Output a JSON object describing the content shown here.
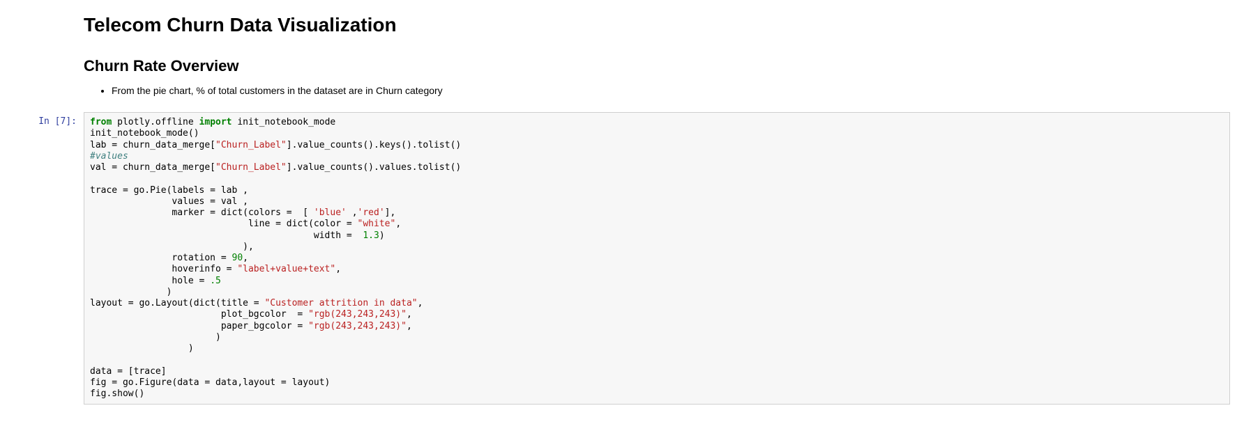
{
  "headings": {
    "h1": "Telecom Churn Data Visualization",
    "h2": "Churn Rate Overview"
  },
  "bullet": "From the pie chart, % of total customers in the dataset are in Churn category",
  "prompt": "In [7]:",
  "code": {
    "l1_from": "from",
    "l1_mod": " plotly.offline ",
    "l1_import": "import",
    "l1_rest": " init_notebook_mode",
    "l2": "init_notebook_mode()",
    "l3_a": "lab = churn_data_merge[",
    "l3_s": "\"Churn_Label\"",
    "l3_b": "].value_counts().keys().tolist()",
    "l4": "#values",
    "l5_a": "val = churn_data_merge[",
    "l5_s": "\"Churn_Label\"",
    "l5_b": "].value_counts().values.tolist()",
    "l7": "trace = go.Pie(labels = lab ,",
    "l8": "               values = val ,",
    "l9_a": "               marker = dict(colors =  [ ",
    "l9_s1": "'blue'",
    "l9_m": " ,",
    "l9_s2": "'red'",
    "l9_b": "],",
    "l10_a": "                             line = dict(color = ",
    "l10_s": "\"white\"",
    "l10_b": ",",
    "l11_a": "                                         width =  ",
    "l11_n": "1.3",
    "l11_b": ")",
    "l12": "                            ),",
    "l13_a": "               rotation = ",
    "l13_n": "90",
    "l13_b": ",",
    "l14_a": "               hoverinfo = ",
    "l14_s": "\"label+value+text\"",
    "l14_b": ",",
    "l15_a": "               hole = ",
    "l15_n": ".5",
    "l16": "              )",
    "l17_a": "layout = go.Layout(dict(title = ",
    "l17_s": "\"Customer attrition in data\"",
    "l17_b": ",",
    "l18_a": "                        plot_bgcolor  = ",
    "l18_s": "\"rgb(243,243,243)\"",
    "l18_b": ",",
    "l19_a": "                        paper_bgcolor = ",
    "l19_s": "\"rgb(243,243,243)\"",
    "l19_b": ",",
    "l20": "                       )",
    "l21": "                  )",
    "l23": "data = [trace]",
    "l24": "fig = go.Figure(data = data,layout = layout)",
    "l25": "fig.show()"
  }
}
